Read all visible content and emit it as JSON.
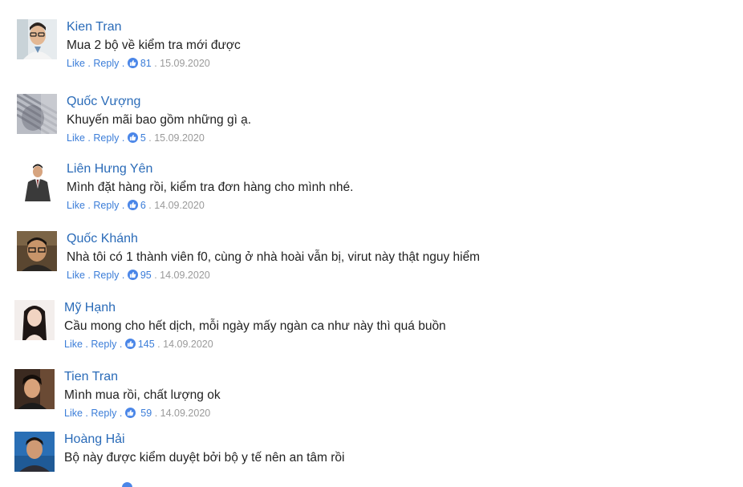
{
  "comments": [
    {
      "name": "Kien Tran",
      "text": "Mua 2 bộ về kiểm tra mới được",
      "like": "Like",
      "reply": "Reply",
      "likes": "81",
      "date": "15.09.2020"
    },
    {
      "name": "Quốc Vượng",
      "text": "Khuyến mãi bao gồm những gì ạ.",
      "like": "Like",
      "reply": "Reply",
      "likes": "5",
      "date": "15.09.2020"
    },
    {
      "name": "Liên Hưng Yên",
      "text": "Mình đặt hàng rồi, kiểm tra đơn hàng cho mình nhé.",
      "like": "Like",
      "reply": "Reply",
      "likes": "6",
      "date": "14.09.2020"
    },
    {
      "name": "Quốc Khánh",
      "text": "Nhà tôi có 1 thành viên f0, cùng ở nhà hoài vẫn bị, virut này thật nguy hiểm",
      "like": "Like",
      "reply": "Reply",
      "likes": "95",
      "date": "14.09.2020"
    },
    {
      "name": "Mỹ Hạnh",
      "text": "Cầu mong cho hết dịch, mỗi ngày mấy ngàn ca như này thì quá buồn",
      "like": "Like",
      "reply": "Reply",
      "likes": "145",
      "date": "14.09.2020"
    },
    {
      "name": "Tien Tran",
      "text": "Mình mua rồi, chất lượng ok",
      "like": "Like",
      "reply": "Reply",
      "likes": "59",
      "date": "14.09.2020"
    },
    {
      "name": "Hoàng Hải",
      "text": "Bộ này được kiểm duyệt bởi bộ y tế nên an tâm rồi",
      "like": "",
      "reply": "",
      "likes": "",
      "date": ""
    }
  ],
  "separator": ".",
  "colors": {
    "name": "#2a6bb8",
    "link": "#3b7dd8",
    "date": "#9a9a9a",
    "text": "#222222",
    "like_icon": "#4a86e8"
  }
}
